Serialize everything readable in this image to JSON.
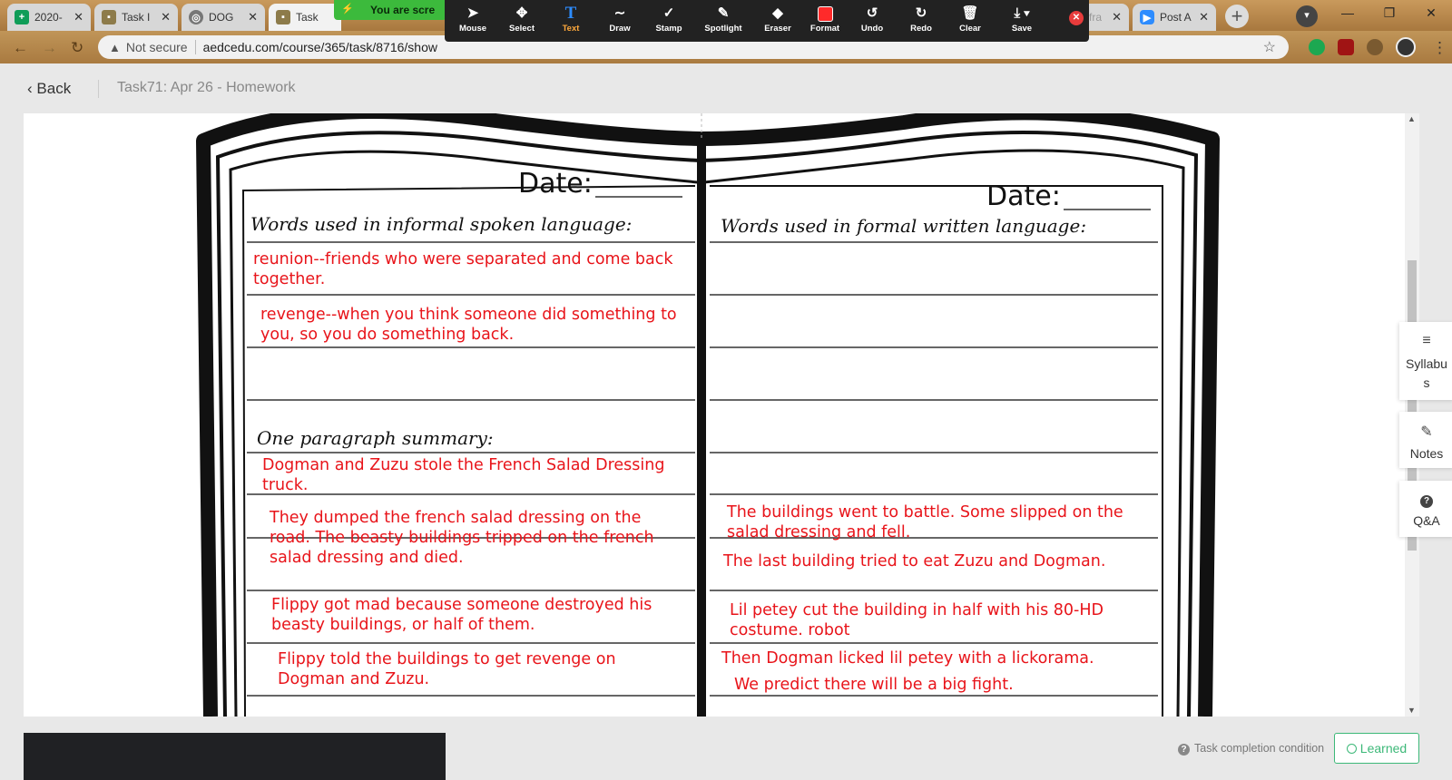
{
  "browser": {
    "tabs": [
      {
        "label": "2020-",
        "favicon_color": "#0f9d58"
      },
      {
        "label": "Task I",
        "favicon_color": "#8d7b4a"
      },
      {
        "label": "DOG",
        "favicon_color": "#777777"
      },
      {
        "label": "Task",
        "favicon_color": "#8d7b4a"
      },
      {
        "label": "fra",
        "favicon_color": "#ffffff"
      },
      {
        "label": "Post A",
        "favicon_color": "#2d8cff"
      }
    ],
    "share_banner": "You are scre",
    "address": {
      "security": "Not secure",
      "host": "aedcedu.com",
      "path": "/course/365/task/8716/show"
    }
  },
  "zoom_toolbar": {
    "tools": [
      {
        "label": "Mouse",
        "icon": "cursor-icon"
      },
      {
        "label": "Select",
        "icon": "move-icon"
      },
      {
        "label": "Text",
        "icon": "text-icon"
      },
      {
        "label": "Draw",
        "icon": "draw-icon"
      },
      {
        "label": "Stamp",
        "icon": "check-icon"
      },
      {
        "label": "Spotlight",
        "icon": "spotlight-icon"
      },
      {
        "label": "Eraser",
        "icon": "eraser-icon"
      },
      {
        "label": "Format",
        "icon": "color-swatch"
      },
      {
        "label": "Undo",
        "icon": "undo-icon"
      },
      {
        "label": "Redo",
        "icon": "redo-icon"
      },
      {
        "label": "Clear",
        "icon": "trash-icon"
      },
      {
        "label": "Save",
        "icon": "save-icon"
      }
    ],
    "format_color": "#ff2a2a"
  },
  "page": {
    "back_label": "Back",
    "task_title": "Task71:  Apr 26 - Homework"
  },
  "worksheet": {
    "left_date": "Date:",
    "right_date": "Date:",
    "left_heading": "Words used in informal spoken language:",
    "right_heading": "Words used in formal written language:",
    "summary_heading": "One paragraph summary:",
    "ink_color": "#e8141a",
    "left_entries": [
      "reunion--friends who were separated and come back\ntogether.",
      "revenge--when you think someone did something to\nyou, so you do something back."
    ],
    "summary_left": [
      "Dogman and Zuzu stole the French Salad Dressing\ntruck.",
      "They dumped the french salad dressing on the\nroad.  The beasty buildings tripped on the french\nsalad dressing and died.",
      "Flippy got mad because someone destroyed his\nbeasty buildings, or half of them.",
      "Flippy told the buildings to get revenge on\nDogman and Zuzu."
    ],
    "summary_right": [
      "The buildings went to battle.  Some slipped on the\nsalad dressing and fell.",
      "The last building tried to eat Zuzu and Dogman.",
      "Lil petey cut the building in half with his 80-HD\ncostume.  robot",
      "Then Dogman licked lil petey with a lickorama.",
      "We predict there will be a big fight."
    ]
  },
  "side_panel": {
    "syllabus": "Syllabus",
    "notes": "Notes",
    "qa": "Q&A"
  },
  "footer": {
    "completion": "Task completion condition",
    "learned": "Learned"
  }
}
